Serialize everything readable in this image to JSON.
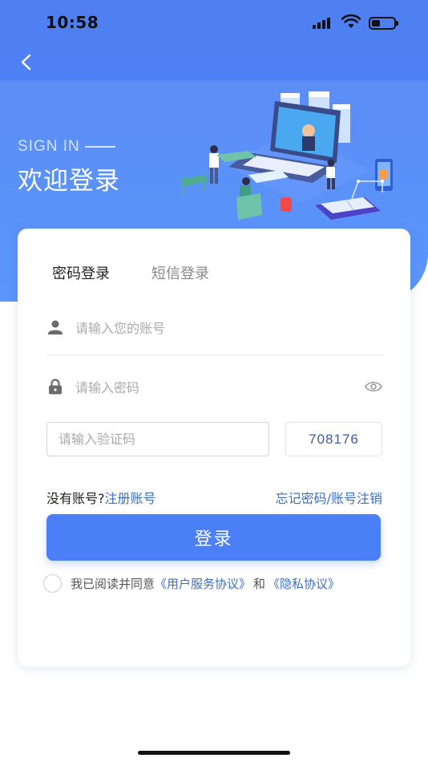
{
  "status_bar": {
    "time": "10:58",
    "battery_level": 0.4
  },
  "header": {
    "sign_in_label": "SIGN IN",
    "welcome_title": "欢迎登录"
  },
  "tabs": {
    "password_login": "密码登录",
    "sms_login": "短信登录"
  },
  "form": {
    "account_placeholder": "请输入您的账号",
    "password_placeholder": "请输入密码",
    "code_placeholder": "请输入验证码",
    "captcha_code": "708176"
  },
  "links": {
    "no_account": "没有账号?",
    "register": "注册账号",
    "forgot": "忘记密码/账号注销"
  },
  "login_button": "登录",
  "agreement": {
    "prefix": "我已阅读并同意",
    "user_agreement": "《用户服务协议》",
    "and": "和",
    "privacy_policy": "《隐私协议》"
  },
  "colors": {
    "primary": "#4a7ff7",
    "link": "#3b6fc4",
    "hero_bg": "#4f86f7"
  }
}
